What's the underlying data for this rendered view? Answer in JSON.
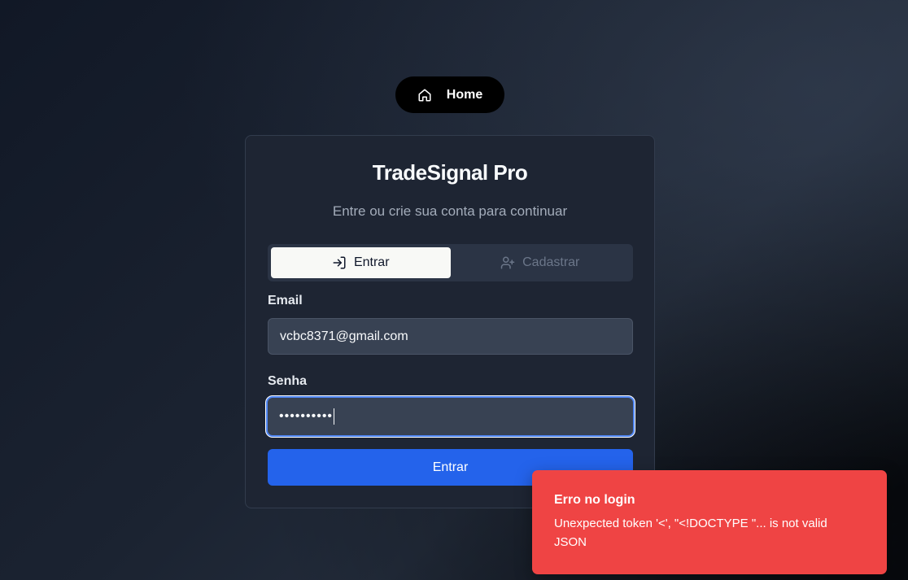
{
  "nav": {
    "home_label": "Home"
  },
  "card": {
    "title": "TradeSignal Pro",
    "subtitle": "Entre ou crie sua conta para continuar"
  },
  "tabs": [
    {
      "label": "Entrar",
      "icon": "log-in-icon",
      "active": true
    },
    {
      "label": "Cadastrar",
      "icon": "user-plus-icon",
      "active": false
    }
  ],
  "form": {
    "email_label": "Email",
    "email_value": "vcbc8371@gmail.com",
    "password_label": "Senha",
    "password_value": "••••••••••",
    "submit_label": "Entrar"
  },
  "toast": {
    "title": "Erro no login",
    "message": "Unexpected token '<', \"<!DOCTYPE \"... is not valid JSON"
  },
  "colors": {
    "accent": "#2463eb",
    "error": "#ef4444",
    "card_bg": "#1e2533"
  }
}
